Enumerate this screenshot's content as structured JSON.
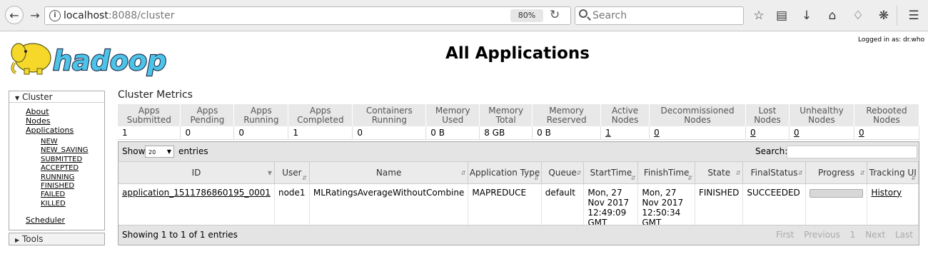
{
  "browser": {
    "url_host": "localhost",
    "url_path": ":8088/cluster",
    "zoom": "80%",
    "search_placeholder": "Search"
  },
  "header": {
    "logged_in": "Logged in as: dr.who",
    "title": "All Applications",
    "logo_text": "hadoop"
  },
  "nav": {
    "cluster_label": "Cluster",
    "tools_label": "Tools",
    "items": [
      "About",
      "Nodes",
      "Applications"
    ],
    "states": [
      "NEW",
      "NEW_SAVING",
      "SUBMITTED",
      "ACCEPTED",
      "RUNNING",
      "FINISHED",
      "FAILED",
      "KILLED"
    ],
    "scheduler": "Scheduler"
  },
  "metrics": {
    "heading": "Cluster Metrics",
    "headers": [
      "Apps Submitted",
      "Apps Pending",
      "Apps Running",
      "Apps Completed",
      "Containers Running",
      "Memory Used",
      "Memory Total",
      "Memory Reserved",
      "Active Nodes",
      "Decommissioned Nodes",
      "Lost Nodes",
      "Unhealthy Nodes",
      "Rebooted Nodes"
    ],
    "values": [
      "1",
      "0",
      "0",
      "1",
      "0",
      "0 B",
      "8 GB",
      "0 B",
      "1",
      "0",
      "0",
      "0",
      "0"
    ]
  },
  "apps": {
    "show_label": "Show",
    "page_size": "20",
    "entries_label": "entries",
    "search_label": "Search:",
    "columns": [
      "ID",
      "User",
      "Name",
      "Application Type",
      "Queue",
      "StartTime",
      "FinishTime",
      "State",
      "FinalStatus",
      "Progress",
      "Tracking UI"
    ],
    "row": {
      "id": "application_1511786860195_0001",
      "user": "node1",
      "name": "MLRatingsAverageWithoutCombine",
      "type": "MAPREDUCE",
      "queue": "default",
      "start": "Mon, 27 Nov 2017 12:49:09 GMT",
      "finish": "Mon, 27 Nov 2017 12:50:34 GMT",
      "state": "FINISHED",
      "final_status": "SUCCEEDED",
      "progress": 1.0,
      "tracking": "History"
    },
    "info": "Showing 1 to 1 of 1 entries",
    "pager": [
      "First",
      "Previous",
      "1",
      "Next",
      "Last"
    ]
  }
}
